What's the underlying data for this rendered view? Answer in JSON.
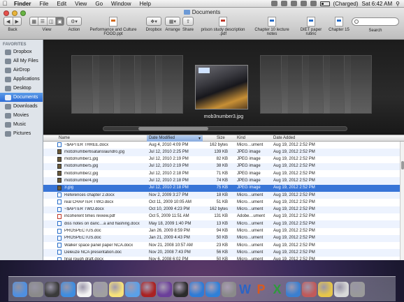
{
  "menubar": {
    "apple": "",
    "items": [
      "Finder",
      "File",
      "Edit",
      "View",
      "Go",
      "Window",
      "Help"
    ],
    "battery": "(Charged)",
    "clock": "Sat 6:42 AM"
  },
  "window": {
    "title": "Documents"
  },
  "toolbar": {
    "back_label": "Back",
    "view_label": "View",
    "action_label": "Action",
    "file1": "Performance and Culture FOOD.ppt",
    "dropbox_label": "Dropbox",
    "arrange_label": "Arrange",
    "share_label": "Share",
    "file2": "prison study description .pdf",
    "file3": "Chapter 10 lecture notes",
    "file4": "DIET paper rubric",
    "file5": "Chapter 15",
    "search_label": "Search"
  },
  "sidebar": {
    "section": "FAVORITES",
    "items": [
      "Dropbox",
      "All My Files",
      "AirDrop",
      "Applications",
      "Desktop",
      "Documents",
      "Downloads",
      "Movies",
      "Music",
      "Pictures"
    ]
  },
  "coverflow": {
    "caption": "mob3number3.jpg"
  },
  "list": {
    "headers": {
      "name": "Name",
      "date": "Date Modified",
      "size": "Size",
      "kind": "Kind",
      "added": "Date Added"
    },
    "rows": [
      {
        "name": "~$APTER THREE.docx",
        "date": "Aug 4, 2010 4:09 PM",
        "size": "162 bytes",
        "kind": "Micro…ument",
        "added": "Aug 19, 2012 2:52 PM",
        "icon": "doc"
      },
      {
        "name": "mob3number6satanslaundro.jpg",
        "date": "Jul 12, 2010 2:25 PM",
        "size": "139 KB",
        "kind": "JPEG image",
        "added": "Aug 19, 2012 2:52 PM",
        "icon": "jpg"
      },
      {
        "name": "mob3number1.jpg",
        "date": "Jul 12, 2010 2:19 PM",
        "size": "82 KB",
        "kind": "JPEG image",
        "added": "Aug 19, 2012 2:52 PM",
        "icon": "jpg"
      },
      {
        "name": "mob3number5.jpg",
        "date": "Jul 12, 2010 2:19 PM",
        "size": "38 KB",
        "kind": "JPEG image",
        "added": "Aug 19, 2012 2:52 PM",
        "icon": "jpg"
      },
      {
        "name": "mob3number2.jpg",
        "date": "Jul 12, 2010 2:18 PM",
        "size": "71 KB",
        "kind": "JPEG image",
        "added": "Aug 19, 2012 2:52 PM",
        "icon": "jpg"
      },
      {
        "name": "mob3number4.jpg",
        "date": "Jul 12, 2010 2:18 PM",
        "size": "74 KB",
        "kind": "JPEG image",
        "added": "Aug 19, 2012 2:52 PM",
        "icon": "jpg"
      },
      {
        "name": "3.jpg",
        "date": "Jul 12, 2010 2:18 PM",
        "size": "75 KB",
        "kind": "JPEG image",
        "added": "Aug 19, 2012 2:52 PM",
        "icon": "jpg",
        "selected": true
      },
      {
        "name": "References chapter 2.docx",
        "date": "Nov 2, 2009 3:27 PM",
        "size": "18 KB",
        "kind": "Micro…ument",
        "added": "Aug 19, 2012 2:52 PM",
        "icon": "doc"
      },
      {
        "name": "real CHAPTER TWO.docx",
        "date": "Oct 11, 2009 10:05 AM",
        "size": "51 KB",
        "kind": "Micro…ument",
        "added": "Aug 19, 2012 2:52 PM",
        "icon": "doc"
      },
      {
        "name": "~$APTER TWO.docx",
        "date": "Oct 10, 2009 4:23 PM",
        "size": "162 bytes",
        "kind": "Micro…ument",
        "added": "Aug 19, 2012 2:52 PM",
        "icon": "doc"
      },
      {
        "name": "incoherent times review.pdf",
        "date": "Oct 5, 2009 11:51 AM",
        "size": "131 KB",
        "kind": "Adobe…ument",
        "added": "Aug 19, 2012 2:52 PM",
        "icon": "pdf"
      },
      {
        "name": "diss notes on danc…a and flashing.docx",
        "date": "May 18, 2009 1:40 PM",
        "size": "13 KB",
        "kind": "Micro…ument",
        "added": "Aug 19, 2012 2:52 PM",
        "icon": "doc"
      },
      {
        "name": "PROSPECTUS.doc",
        "date": "Jan 26, 2009 8:59 PM",
        "size": "94 KB",
        "kind": "Micro…ument",
        "added": "Aug 19, 2012 2:52 PM",
        "icon": "doc"
      },
      {
        "name": "PROSPECTUS.doc",
        "date": "Jan 21, 2009 4:43 PM",
        "size": "50 KB",
        "kind": "Micro…ument",
        "added": "Aug 19, 2012 2:52 PM",
        "icon": "doc"
      },
      {
        "name": "Walker space panel paper NCA.docx",
        "date": "Nov 21, 2008 10:57 AM",
        "size": "23 KB",
        "kind": "Micro…ument",
        "added": "Aug 19, 2012 2:52 PM",
        "icon": "doc"
      },
      {
        "name": "Deleuze NCA presentation.doc",
        "date": "Nov 20, 2008 7:43 PM",
        "size": "56 KB",
        "kind": "Micro…ument",
        "added": "Aug 19, 2012 2:52 PM",
        "icon": "doc"
      },
      {
        "name": "final rough draft.docx",
        "date": "Nov 6, 2008 6:02 PM",
        "size": "50 KB",
        "kind": "Micro…ument",
        "added": "Aug 19, 2012 2:52 PM",
        "icon": "doc"
      }
    ]
  },
  "dock": {
    "icons": [
      {
        "name": "finder-icon",
        "color": "#4f8fe0"
      },
      {
        "name": "launchpad-icon",
        "color": "#8a8a8a"
      },
      {
        "name": "mission-control-icon",
        "color": "#3a3a3a"
      },
      {
        "name": "safari-icon",
        "color": "#3e8de0"
      },
      {
        "name": "calendar-icon",
        "color": "#f2f2f2"
      },
      {
        "name": "help-icon",
        "color": "#a0a0a0"
      },
      {
        "name": "notes-icon",
        "color": "#f7e27a"
      },
      {
        "name": "messages-icon",
        "color": "#5aa0e8"
      },
      {
        "name": "photo-booth-icon",
        "color": "#a22"
      },
      {
        "name": "itunes-icon",
        "color": "#6b3f9a"
      },
      {
        "name": "iphoto-icon",
        "color": "#2b2b2b"
      },
      {
        "name": "itunes-blue-icon",
        "color": "#2e7bd6"
      },
      {
        "name": "app-store-icon",
        "color": "#2f80d8"
      },
      {
        "name": "system-preferences-icon",
        "color": "#8a8a8a"
      },
      {
        "name": "word-icon",
        "color": "#2b64c4",
        "letter": "W"
      },
      {
        "name": "powerpoint-icon",
        "color": "#d95a1f",
        "letter": "P"
      },
      {
        "name": "excel-icon",
        "color": "#2e9a3c",
        "letter": "X"
      },
      {
        "name": "entourage-icon",
        "color": "#3a7fd0"
      },
      {
        "name": "utilities-icon",
        "color": "#c05a5a"
      },
      {
        "name": "stickies-icon",
        "color": "#e6c54a"
      },
      {
        "name": "documents-stack-icon",
        "color": "#d8d8d8"
      },
      {
        "name": "trash-icon",
        "color": "#9a9a9a"
      }
    ]
  }
}
